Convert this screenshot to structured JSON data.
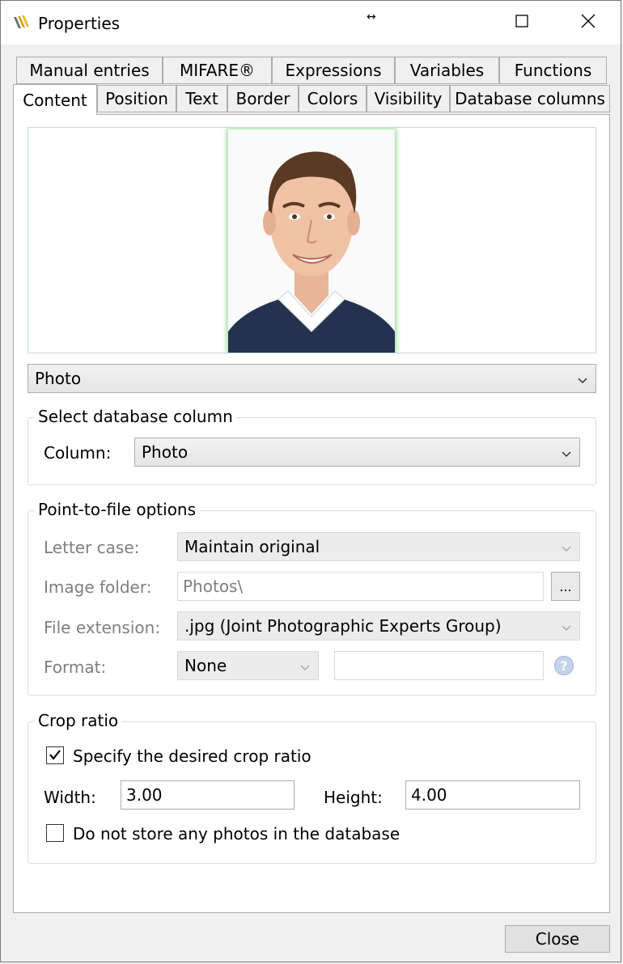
{
  "window": {
    "title": "Properties"
  },
  "tabs_row1": [
    {
      "label": "Manual entries"
    },
    {
      "label": "MIFARE®"
    },
    {
      "label": "Expressions"
    },
    {
      "label": "Variables"
    },
    {
      "label": "Functions"
    }
  ],
  "tabs_row2": [
    {
      "label": "Content"
    },
    {
      "label": "Position"
    },
    {
      "label": "Text"
    },
    {
      "label": "Border"
    },
    {
      "label": "Colors"
    },
    {
      "label": "Visibility"
    },
    {
      "label": "Database columns"
    }
  ],
  "content": {
    "source_select": "Photo",
    "db_group": {
      "title": "Select database column",
      "column_label": "Column:",
      "column_value": "Photo"
    },
    "ptf_group": {
      "title": "Point-to-file options",
      "letter_case_label": "Letter case:",
      "letter_case_value": "Maintain original",
      "image_folder_label": "Image folder:",
      "image_folder_value": "Photos\\",
      "browse_label": "...",
      "file_ext_label": "File extension:",
      "file_ext_value": ".jpg (Joint Photographic Experts Group)",
      "format_label": "Format:",
      "format_value": "None",
      "format_text": "",
      "help_label": "?"
    },
    "crop_group": {
      "title": "Crop ratio",
      "specify_label": "Specify the desired crop ratio",
      "specify_checked": true,
      "width_label": "Width:",
      "width_value": "3.00",
      "height_label": "Height:",
      "height_value": "4.00",
      "nostore_label": "Do not store any photos in the database",
      "nostore_checked": false
    }
  },
  "footer": {
    "close_label": "Close"
  }
}
